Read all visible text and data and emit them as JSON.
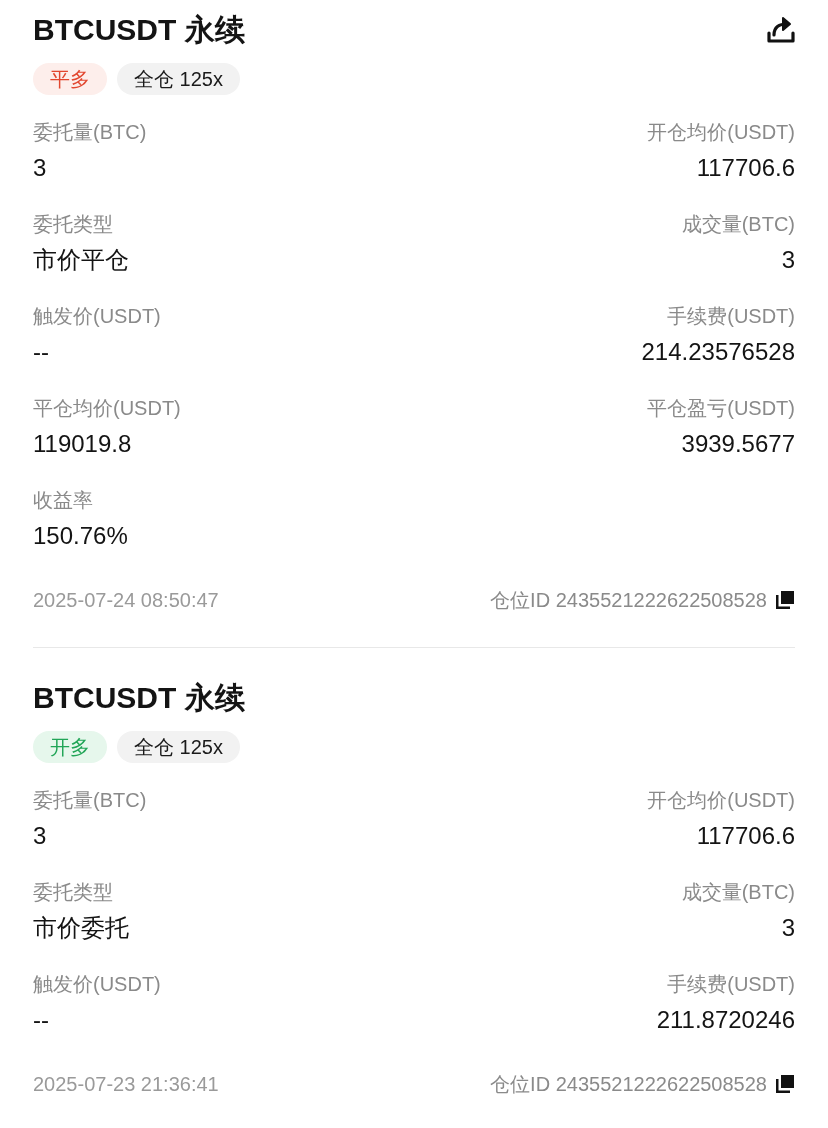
{
  "orders": [
    {
      "title": "BTCUSDT 永续",
      "share": true,
      "tags": [
        {
          "label": "平多",
          "kind": "close_long"
        },
        {
          "label": "全仓 125x",
          "kind": "margin"
        }
      ],
      "fields": [
        {
          "label": "委托量(BTC)",
          "value": "3"
        },
        {
          "label": "开仓均价(USDT)",
          "value": "117706.6"
        },
        {
          "label": "委托类型",
          "value": "市价平仓"
        },
        {
          "label": "成交量(BTC)",
          "value": "3"
        },
        {
          "label": "触发价(USDT)",
          "value": "--"
        },
        {
          "label": "手续费(USDT)",
          "value": "214.23576528"
        },
        {
          "label": "平仓均价(USDT)",
          "value": "119019.8"
        },
        {
          "label": "平仓盈亏(USDT)",
          "value": "3939.5677"
        },
        {
          "label": "收益率",
          "value": "150.76%"
        }
      ],
      "time": "2025-07-24 08:50:47",
      "position_id": "仓位ID 2435521222622508528"
    },
    {
      "title": "BTCUSDT 永续",
      "share": false,
      "tags": [
        {
          "label": "开多",
          "kind": "open_long"
        },
        {
          "label": "全仓 125x",
          "kind": "margin"
        }
      ],
      "fields": [
        {
          "label": "委托量(BTC)",
          "value": "3"
        },
        {
          "label": "开仓均价(USDT)",
          "value": "117706.6"
        },
        {
          "label": "委托类型",
          "value": "市价委托"
        },
        {
          "label": "成交量(BTC)",
          "value": "3"
        },
        {
          "label": "触发价(USDT)",
          "value": "--"
        },
        {
          "label": "手续费(USDT)",
          "value": "211.8720246"
        }
      ],
      "time": "2025-07-23 21:36:41",
      "position_id": "仓位ID 2435521222622508528"
    }
  ]
}
